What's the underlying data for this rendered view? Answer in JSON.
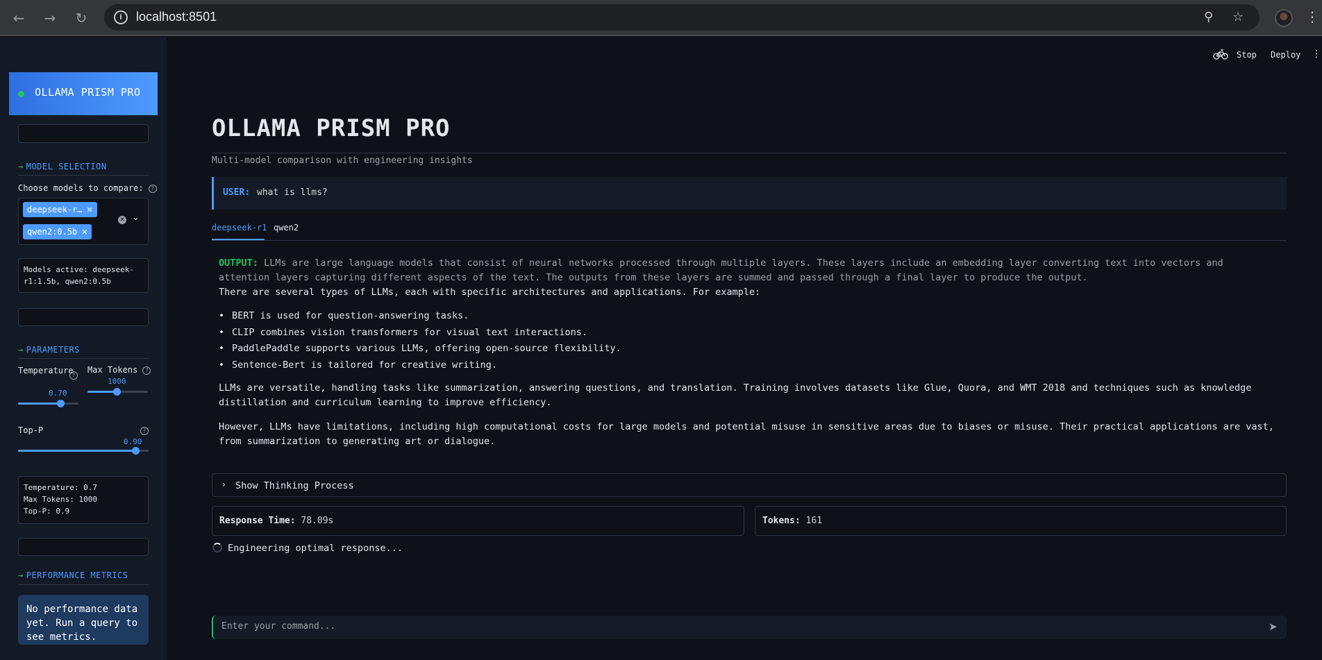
{
  "browser": {
    "url": "localhost:8501",
    "back_icon": "←",
    "forward_icon": "→",
    "reload_icon": "↻"
  },
  "sidebar": {
    "brand": "OLLAMA PRISM PRO",
    "sections": {
      "model_selection": "MODEL SELECTION",
      "parameters": "PARAMETERS",
      "performance": "PERFORMANCE METRICS"
    },
    "choose_label": "Choose models to compare:",
    "selected_models": [
      "deepseek-r…",
      "qwen2:0.5b"
    ],
    "models_active": "Models active: deepseek-r1:1.5b, qwen2:0.5b",
    "temperature": {
      "label": "Temperature",
      "value": "0.70",
      "fraction": 0.7
    },
    "max_tokens": {
      "label": "Max Tokens",
      "value": "1000",
      "fraction": 0.48
    },
    "top_p": {
      "label": "Top-P",
      "value": "0.90",
      "fraction": 0.9
    },
    "param_summary": [
      "Temperature: 0.7",
      "Max Tokens: 1000",
      "Top-P: 0.9"
    ],
    "perf_note": "No performance data yet. Run a query to see metrics."
  },
  "toolbar": {
    "stop": "Stop",
    "deploy": "Deploy"
  },
  "main": {
    "title": "OLLAMA PRISM PRO",
    "subtitle": "Multi-model comparison with engineering insights",
    "user_label": "USER:",
    "user_query": "what is llms?",
    "tabs": [
      "deepseek-r1",
      "qwen2"
    ],
    "output_label": "OUTPUT:",
    "output_intro": "LLMs are large language models that consist of neural networks processed through multiple layers. These layers include an embedding layer converting text into vectors and attention layers capturing different aspects of the text. The outputs from these layers are summed and passed through a final layer to produce the output.",
    "types_line": "There are several types of LLMs, each with specific architectures and applications. For example:",
    "bullets": [
      "BERT is used for question-answering tasks.",
      "CLIP combines vision transformers for visual text interactions.",
      "PaddlePaddle supports various LLMs, offering open-source flexibility.",
      "Sentence-Bert is tailored for creative writing."
    ],
    "para2": "LLMs are versatile, handling tasks like summarization, answering questions, and translation. Training involves datasets like Glue, Quora, and WMT 2018 and techniques such as knowledge distillation and curriculum learning to improve efficiency.",
    "para3": "However, LLMs have limitations, including high computational costs for large models and potential misuse in sensitive areas due to biases or misuse. Their practical applications are vast, from summarization to generating art or dialogue.",
    "thinking": "Show Thinking Process",
    "response_time_label": "Response Time:",
    "response_time": "78.09s",
    "tokens_label": "Tokens:",
    "tokens": "161",
    "spinner_text": "Engineering optimal response...",
    "chat_placeholder": "Enter your command..."
  }
}
